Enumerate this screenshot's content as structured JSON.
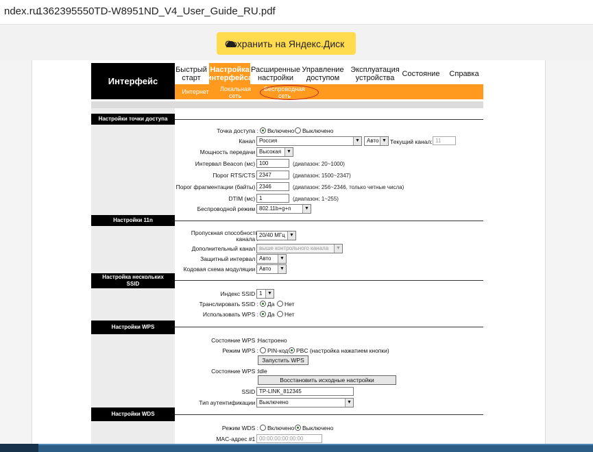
{
  "browser": {
    "domain": "ndex.ru",
    "file_name": "1362395550TD-W8951ND_V4_User_Guide_RU.pdf"
  },
  "viewer": {
    "save_button": "Сохранить на Яндекс.Диск"
  },
  "router": {
    "header_title": "Интерфейс",
    "nav": [
      "Быстрый старт",
      "Настройка интерфейса",
      "Расширенные настройки",
      "Управление доступом",
      "Эксплуатация устройства",
      "Состояние",
      "Справка"
    ],
    "subnav": [
      "Интернет",
      "Локальная сеть",
      "Беспроводная сеть"
    ],
    "ap": {
      "title": "Настройки точки доступа",
      "access_point_label": "Точка доступа :",
      "on": "Включено",
      "off": "Выключено",
      "channel_label": "Канал :",
      "country": "Россия",
      "channel_mode": "Авто",
      "current_channel_label": "Текущий канал:",
      "current_channel": "11",
      "power_label": "Мощность передачи :",
      "power": "Высокая",
      "beacon_label": "Интервал Beacon (мс) :",
      "beacon": "100",
      "beacon_hint": "(диапазон: 20~1000)",
      "rts_label": "Порог RTS/CTS :",
      "rts": "2347",
      "rts_hint": "(диапазон: 1500~2347)",
      "frag_label": "Порог фрагментации (байты) :",
      "frag": "2346",
      "frag_hint": "(диапазон: 256~2346, только четные числа)",
      "dtim_label": "DTIM (мс) :",
      "dtim": "1",
      "dtim_hint": "(диапазон: 1~255)",
      "mode_label": "Беспроводной режим :",
      "mode": "802.11b+g+n"
    },
    "n11": {
      "title": "Настройки 11n",
      "bandwidth_label_1": "Пропускная способность",
      "bandwidth_label_2": "канала :",
      "bandwidth": "20/40 МГц",
      "ext_channel_label": "Дополнительный канал :",
      "ext_channel": "выше контрольного канала",
      "guard_label": "Защитный интервал :",
      "guard": "Авто",
      "mcs_label": "Кодовая схема модуляции :",
      "mcs": "Авто"
    },
    "ssid": {
      "title": "Настройка нескольких SSID",
      "index_label": "Индекс SSID :",
      "index": "1",
      "broadcast_label": "Транслировать SSID :",
      "yes": "Да",
      "no": "Нет",
      "wps_use_label": "Использовать WPS :"
    },
    "wps": {
      "title": "Настройки WPS",
      "state_label": "Состояние WPS :",
      "state": "Настроено",
      "mode_label": "Режим WPS :",
      "pin": "PIN-код",
      "pbc": "PBC (настройка нажатием кнопки)",
      "start_button": "Запустить WPS",
      "status_label": "Состояние WPS :",
      "status": "Idle",
      "reset_button": "Восстановить исходные настройки",
      "ssid_label": "SSID :",
      "ssid_value": "TP-LINK_812345",
      "auth_label": "Тип аутентификации :",
      "auth": "Выключено"
    },
    "wds": {
      "title": "Настройки WDS",
      "mode_label": "Режим WDS :",
      "on": "Включено",
      "off": "Выключено",
      "mac1_label": "MAC-адрес #1 :",
      "mac1": "00:00:00:00:00:00"
    }
  }
}
